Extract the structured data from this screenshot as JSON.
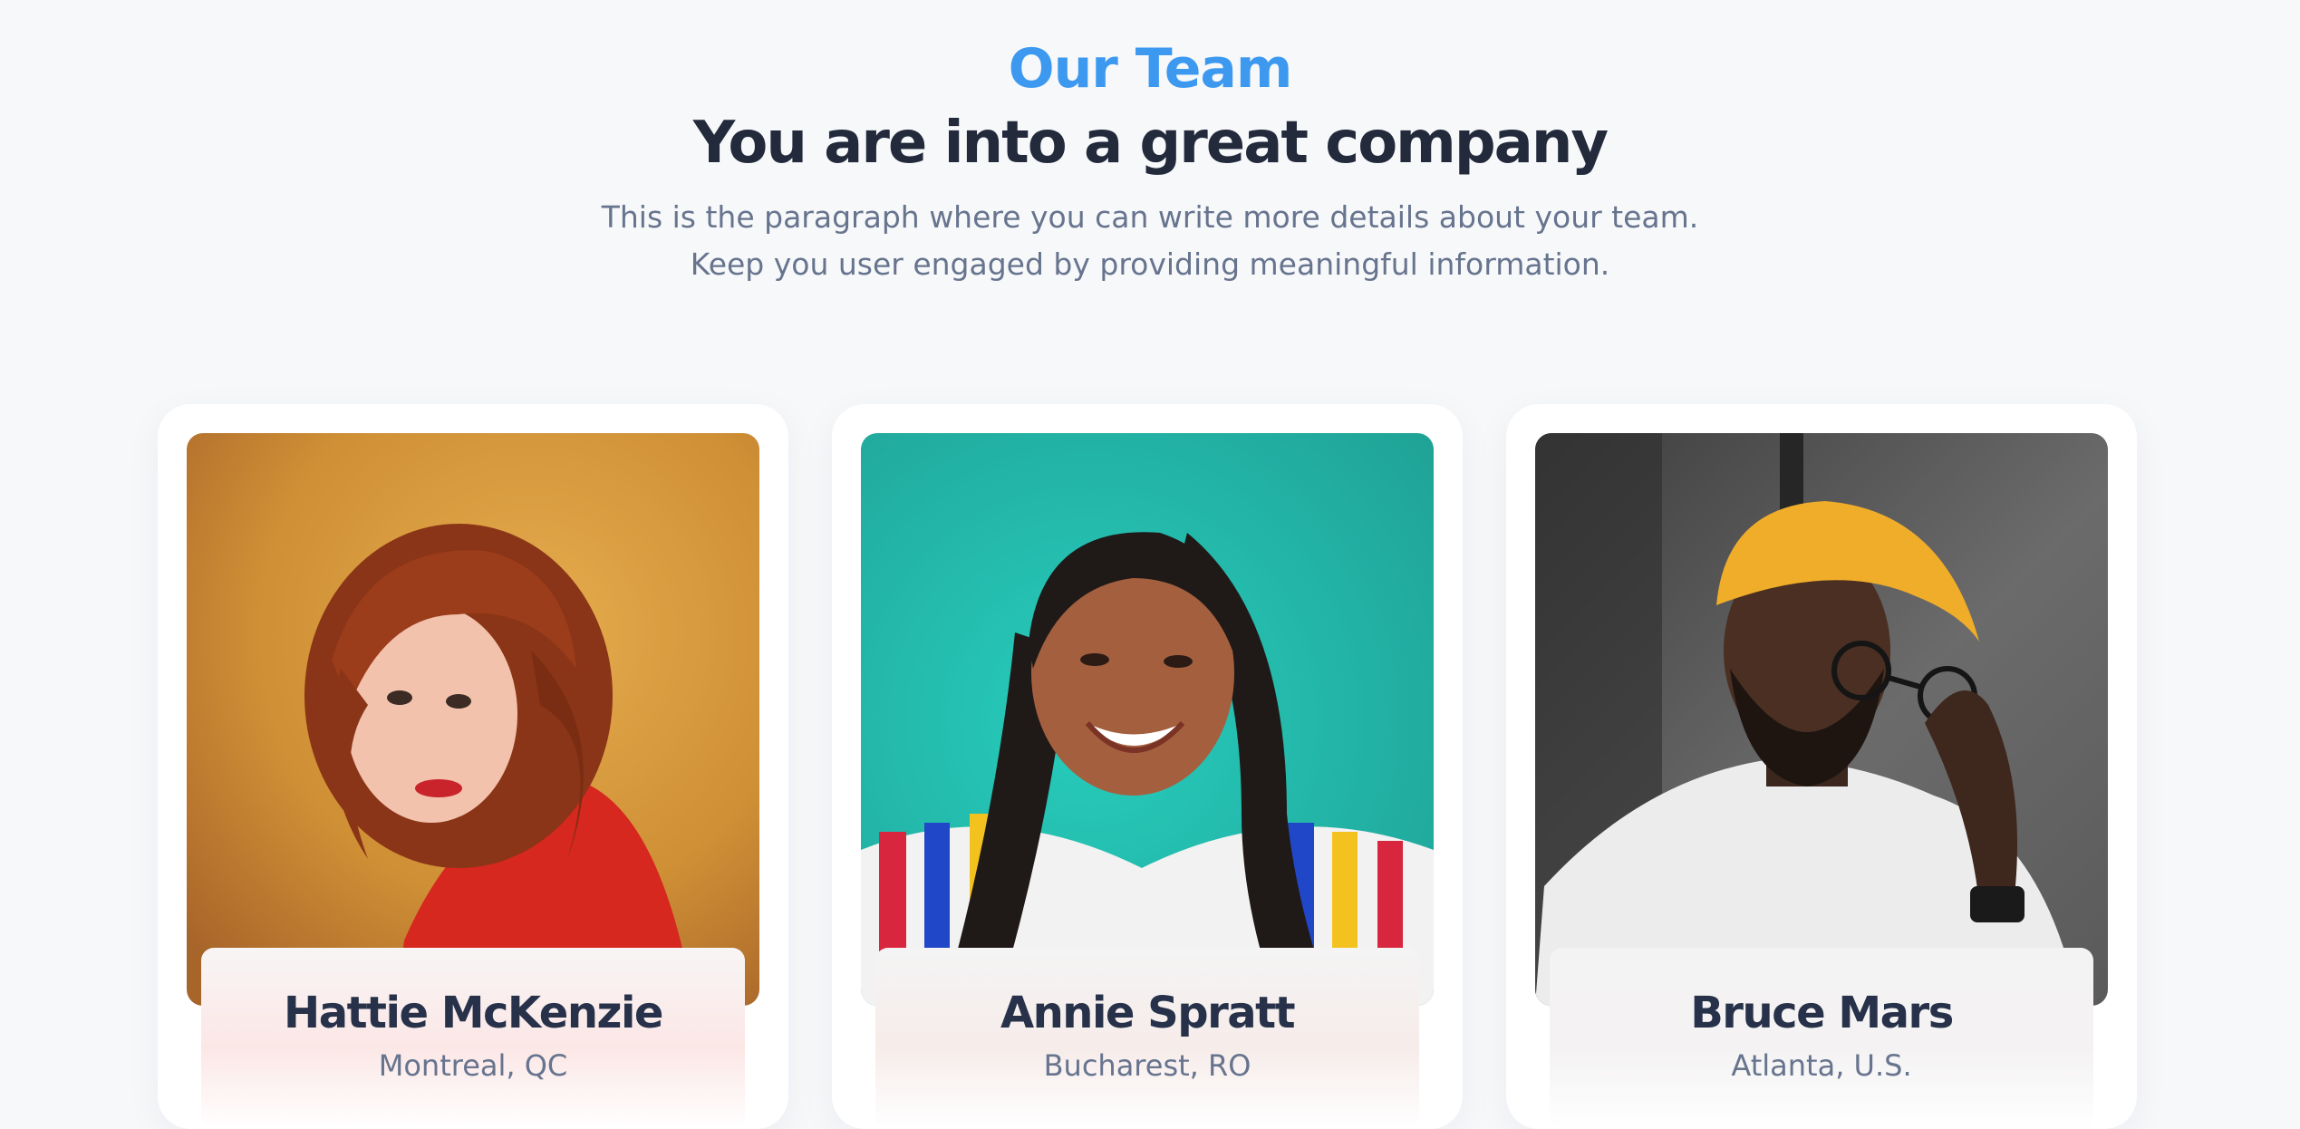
{
  "section": {
    "eyebrow": "Our Team",
    "title": "You are into a great company",
    "lead": "This is the paragraph where you can write more details about your team. Keep you user engaged by providing meaningful information."
  },
  "colors": {
    "accent": "#3d99f0",
    "heading": "#222a3b",
    "muted": "#67748e",
    "background": "#f7f8fa"
  },
  "team": [
    {
      "name": "Hattie McKenzie",
      "location": "Montreal, QC",
      "photo": "portrait-woman-red-hair-orange-background"
    },
    {
      "name": "Annie Spratt",
      "location": "Bucharest, RO",
      "photo": "portrait-woman-braids-teal-background"
    },
    {
      "name": "Bruce Mars",
      "location": "Atlanta, U.S.",
      "photo": "portrait-man-yellow-beanie-grey-background"
    }
  ]
}
